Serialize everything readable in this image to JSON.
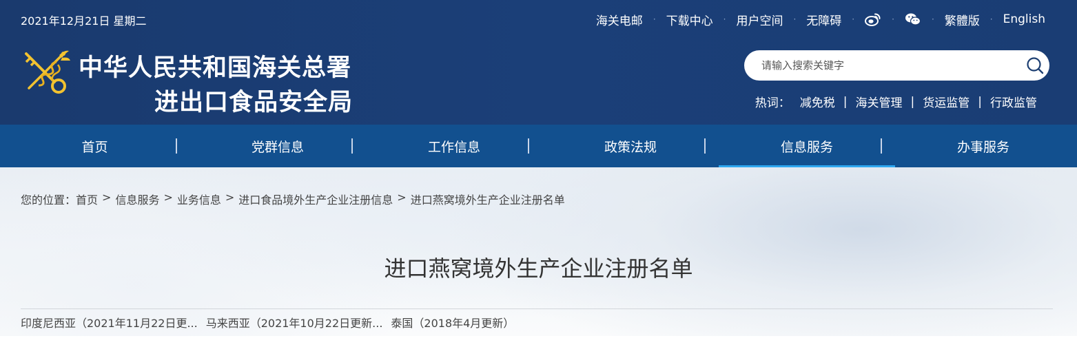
{
  "header": {
    "date": "2021年12月21日 星期二",
    "toplinks": [
      "海关电邮",
      "下载中心",
      "用户空间",
      "无障碍"
    ],
    "social_icons": [
      "weibo-icon",
      "wechat-icon"
    ],
    "lang_links": [
      "繁體版",
      "English"
    ],
    "title_line1": "中华人民共和国海关总署",
    "title_line2": "进出口食品安全局",
    "search_placeholder": "请输入搜索关键字",
    "hotwords_label": "热词：",
    "hotwords": [
      "减免税",
      "海关管理",
      "货运监管",
      "行政监管"
    ]
  },
  "nav": {
    "items": [
      "首页",
      "党群信息",
      "工作信息",
      "政策法规",
      "信息服务",
      "办事服务"
    ],
    "active": "信息服务"
  },
  "breadcrumb": {
    "lead": "您的位置：",
    "items": [
      "首页",
      "信息服务",
      "业务信息",
      "进口食品境外生产企业注册信息",
      "进口燕窝境外生产企业注册名单"
    ]
  },
  "page_title": "进口燕窝境外生产企业注册名单",
  "listing": [
    "印度尼西亚（2021年11月22日更...",
    "马来西亚（2021年10月22日更新...",
    "泰国（2018年4月更新）"
  ],
  "colors": {
    "header_bg": "#1a3a6e",
    "nav_bg": "#12508f",
    "nav_active_underline": "#2ea7f0"
  }
}
